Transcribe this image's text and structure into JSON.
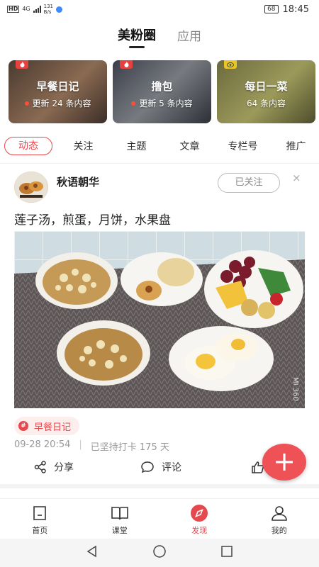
{
  "status": {
    "left": {
      "hd": "HD",
      "net_type": "4G",
      "speed_value": "131",
      "speed_unit": "B/s"
    },
    "battery": "68",
    "time": "18:45"
  },
  "top_tabs": [
    "美粉圈",
    "应用"
  ],
  "cards": [
    {
      "title": "早餐日记",
      "update": "更新 24 条内容",
      "badge": "fire",
      "has_dot": true
    },
    {
      "title": "撸包",
      "update": "更新 5 条内容",
      "badge": "fire",
      "has_dot": true
    },
    {
      "title": "每日一菜",
      "update": "64 条内容",
      "badge": "eye",
      "has_dot": false
    }
  ],
  "category_tabs": [
    "动态",
    "关注",
    "主题",
    "文章",
    "专栏号",
    "推广"
  ],
  "post": {
    "username": "秋语朝华",
    "follow_label": "已关注",
    "close": "×",
    "text": "莲子汤，煎蛋，月饼，水果盘",
    "watermark": "MI 360",
    "topic": "早餐日记",
    "date": "09-28 20:54",
    "streak": "已坚持打卡 175 天",
    "share_label": "分享",
    "comment_label": "评论"
  },
  "fab_label": "+",
  "bottom_nav": [
    "首页",
    "课堂",
    "发现",
    "我的"
  ],
  "colors": {
    "accent": "#e5484d",
    "fab": "#ee5257"
  }
}
